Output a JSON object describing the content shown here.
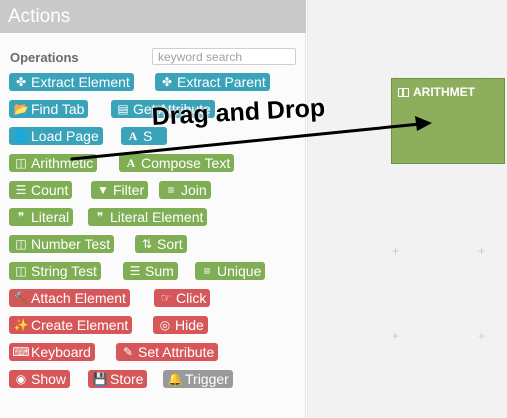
{
  "sidebar": {
    "title": "Actions",
    "operations_label": "Operations",
    "search_placeholder": "keyword search",
    "buttons": [
      {
        "label": "Extract Element",
        "icon": "✤"
      },
      {
        "label": "Extract Parent",
        "icon": "✤"
      },
      {
        "label": "Find Tab",
        "icon": "📂"
      },
      {
        "label": "Get Attribute",
        "icon": "▤"
      },
      {
        "label": "Load Page",
        "icon": "🌐"
      },
      {
        "label": "S",
        "icon": "A"
      },
      {
        "label": "Arithmetic",
        "icon": "◫"
      },
      {
        "label": "Compose Text",
        "icon": "A"
      },
      {
        "label": "Count",
        "icon": "☰"
      },
      {
        "label": "Filter",
        "icon": "▼"
      },
      {
        "label": "Join",
        "icon": "≡"
      },
      {
        "label": "Literal",
        "icon": "❞"
      },
      {
        "label": "Literal Element",
        "icon": "❞"
      },
      {
        "label": "Number Test",
        "icon": "◫"
      },
      {
        "label": "Sort",
        "icon": "⇅"
      },
      {
        "label": "String Test",
        "icon": "◫"
      },
      {
        "label": "Sum",
        "icon": "☰"
      },
      {
        "label": "Unique",
        "icon": "≡"
      },
      {
        "label": "Attach Element",
        "icon": "🔨"
      },
      {
        "label": "Click",
        "icon": "☞"
      },
      {
        "label": "Create Element",
        "icon": "✨"
      },
      {
        "label": "Hide",
        "icon": "◎"
      },
      {
        "label": "Keyboard",
        "icon": "⌨"
      },
      {
        "label": "Set Attribute",
        "icon": "✎"
      },
      {
        "label": "Show",
        "icon": "◉"
      },
      {
        "label": "Store",
        "icon": "💾"
      },
      {
        "label": "Trigger",
        "icon": "🔔"
      }
    ]
  },
  "canvas": {
    "block_title": "ARITHMET",
    "annotation": "Drag and Drop"
  },
  "colors": {
    "teal": "#3aa2b9",
    "green": "#7fae55",
    "red": "#d5575a",
    "gray": "#9a9a9a"
  }
}
